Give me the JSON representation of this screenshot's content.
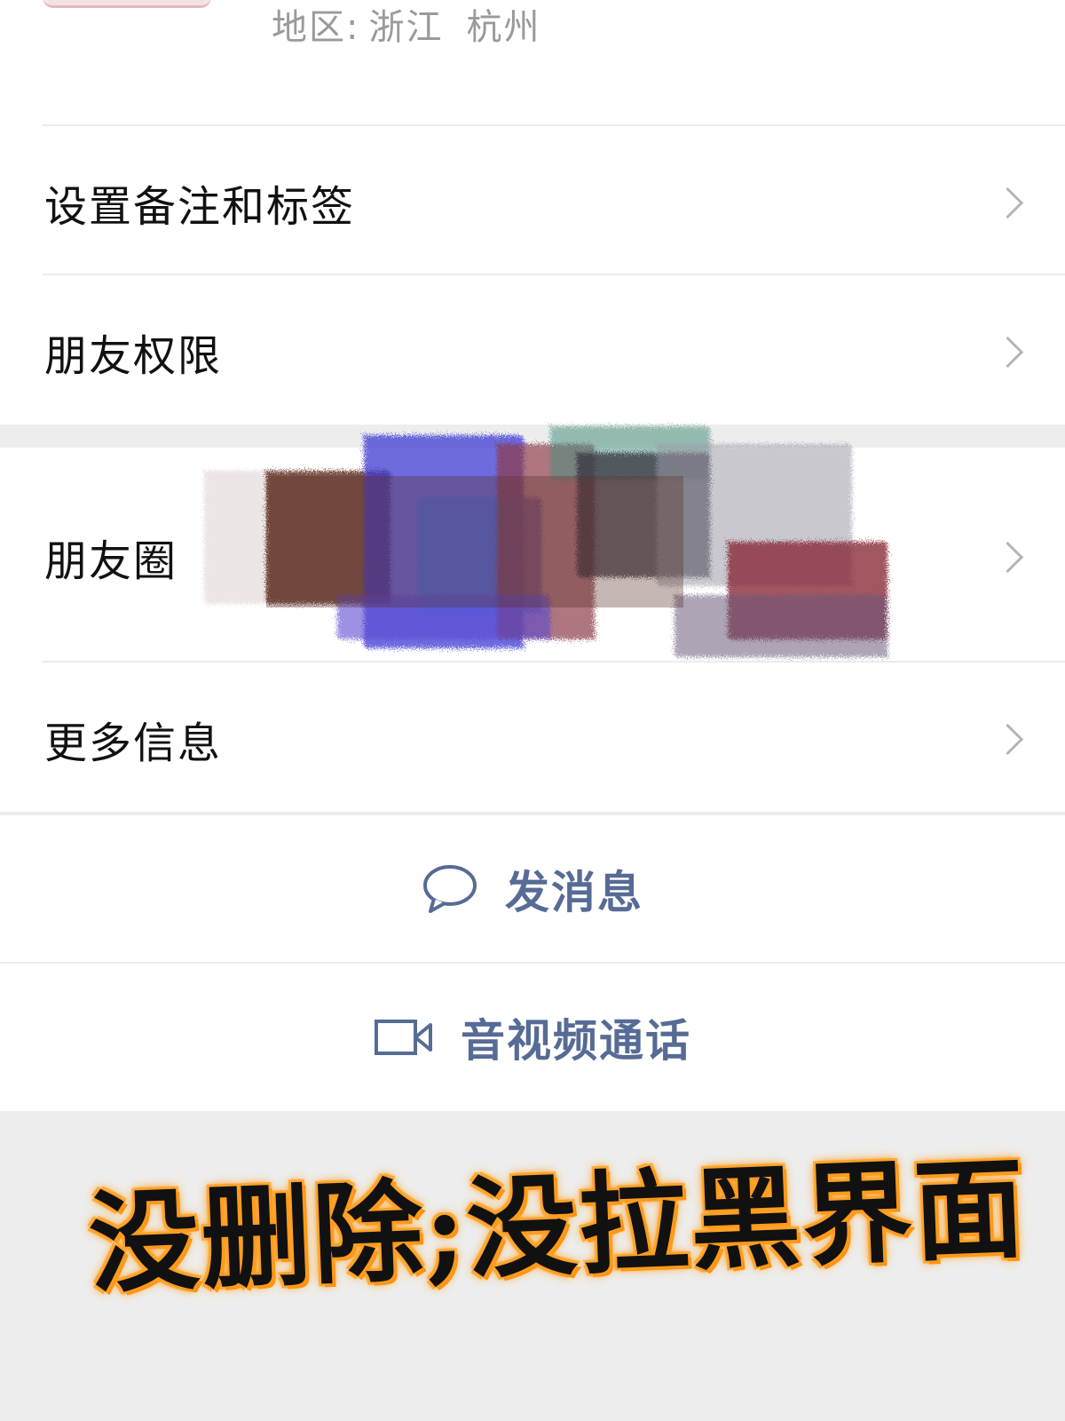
{
  "profile": {
    "region_label": "地区:",
    "region_province": "浙江",
    "region_city": "杭州"
  },
  "menu": {
    "remarks_tags": "设置备注和标签",
    "friend_permissions": "朋友权限",
    "moments": "朋友圈",
    "more_info": "更多信息"
  },
  "actions": {
    "send_message": "发消息",
    "av_call": "音视频通话"
  },
  "overlay": {
    "caption": "没删除;没拉黑界面"
  },
  "colors": {
    "action_text": "#566b95",
    "caption_glow": "#ff9a1a",
    "background": "#ededed"
  },
  "icons": {
    "chevron": "chevron-right-icon",
    "message": "chat-bubble-icon",
    "video": "video-camera-icon"
  }
}
